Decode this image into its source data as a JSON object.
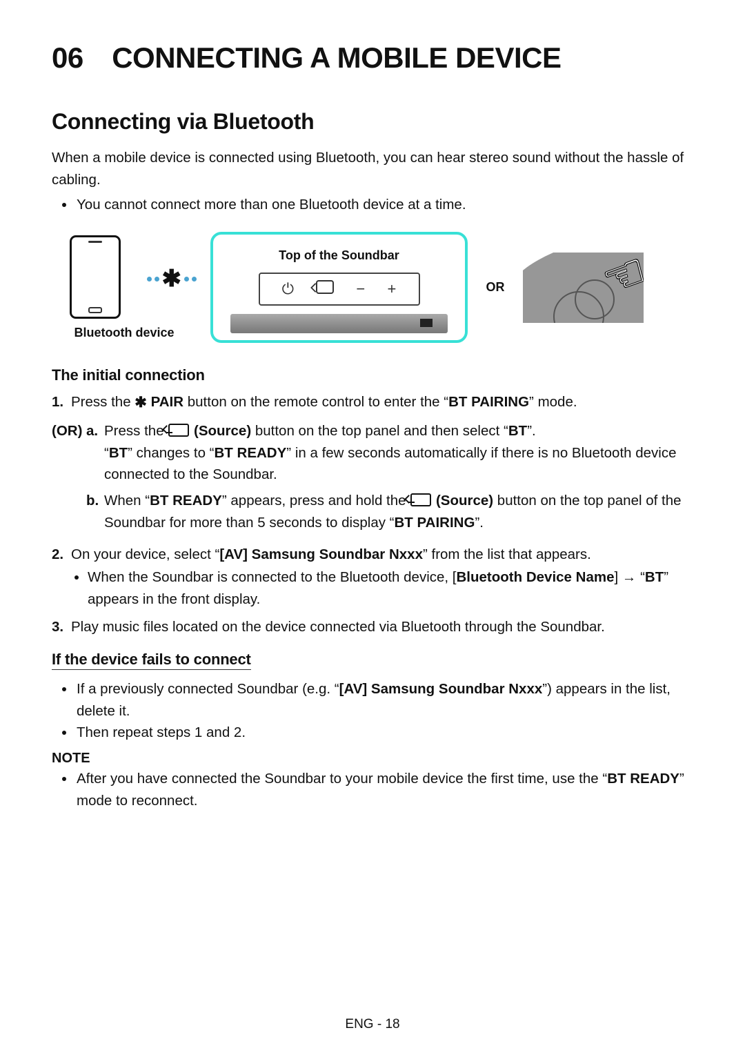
{
  "h1": "06 CONNECTING A MOBILE DEVICE",
  "h2": "Connecting via Bluetooth",
  "intro": "When a mobile device is connected using Bluetooth, you can hear stereo sound without the hassle of cabling.",
  "intro_bullet": "You cannot connect more than one Bluetooth device at a time.",
  "diagram": {
    "bt_device_label": "Bluetooth device",
    "top_label": "Top of the Soundbar",
    "or": "OR"
  },
  "sec_initial": "The initial connection",
  "step1_num": "1.",
  "step1_a": "Press the ",
  "step1_pair": " PAIR",
  "step1_b": " button on the remote control to enter the “",
  "step1_c": "BT PAIRING",
  "step1_d": "” mode.",
  "or_word": "(OR)",
  "sub_a_let": "a.",
  "sub_a_1": "Press the ",
  "sub_a_src": " (Source)",
  "sub_a_2": " button on the top panel and then select “",
  "sub_a_bt": "BT",
  "sub_a_3": "”.",
  "sub_a_line2a": "“",
  "sub_a_line2b": "BT",
  "sub_a_line2c": "” changes to “",
  "sub_a_line2d": "BT READY",
  "sub_a_line2e": "” in a few seconds automatically if there is no Bluetooth device connected to the Soundbar.",
  "sub_b_let": "b.",
  "sub_b_1": "When “",
  "sub_b_2": "BT READY",
  "sub_b_3": "” appears, press and hold the ",
  "sub_b_src": " (Source)",
  "sub_b_4": " button on the top panel of the Soundbar for more than 5 seconds to display “",
  "sub_b_5": "BT PAIRING",
  "sub_b_6": "”.",
  "step2_num": "2.",
  "step2_a": "On your device, select “",
  "step2_b": "[AV] Samsung Soundbar Nxxx",
  "step2_c": "” from the list that appears.",
  "step2_sub_a": "When the Soundbar is connected to the Bluetooth device, [",
  "step2_sub_b": "Bluetooth Device Name",
  "step2_sub_c": "] → “",
  "step2_sub_d": "BT",
  "step2_sub_e": "” appears in the front display.",
  "step3_num": "3.",
  "step3": "Play music files located on the device connected via Bluetooth through the Soundbar.",
  "sec_fail": "If the device fails to connect",
  "fail_b1_a": "If a previously connected Soundbar (e.g. “",
  "fail_b1_b": "[AV] Samsung Soundbar Nxxx",
  "fail_b1_c": "”) appears in the list, delete it.",
  "fail_b2": "Then repeat steps 1 and 2.",
  "note_head": "NOTE",
  "note_a": "After you have connected the Soundbar to your mobile device the first time, use the “",
  "note_b": "BT READY",
  "note_c": "” mode to reconnect.",
  "footer": "ENG - 18"
}
